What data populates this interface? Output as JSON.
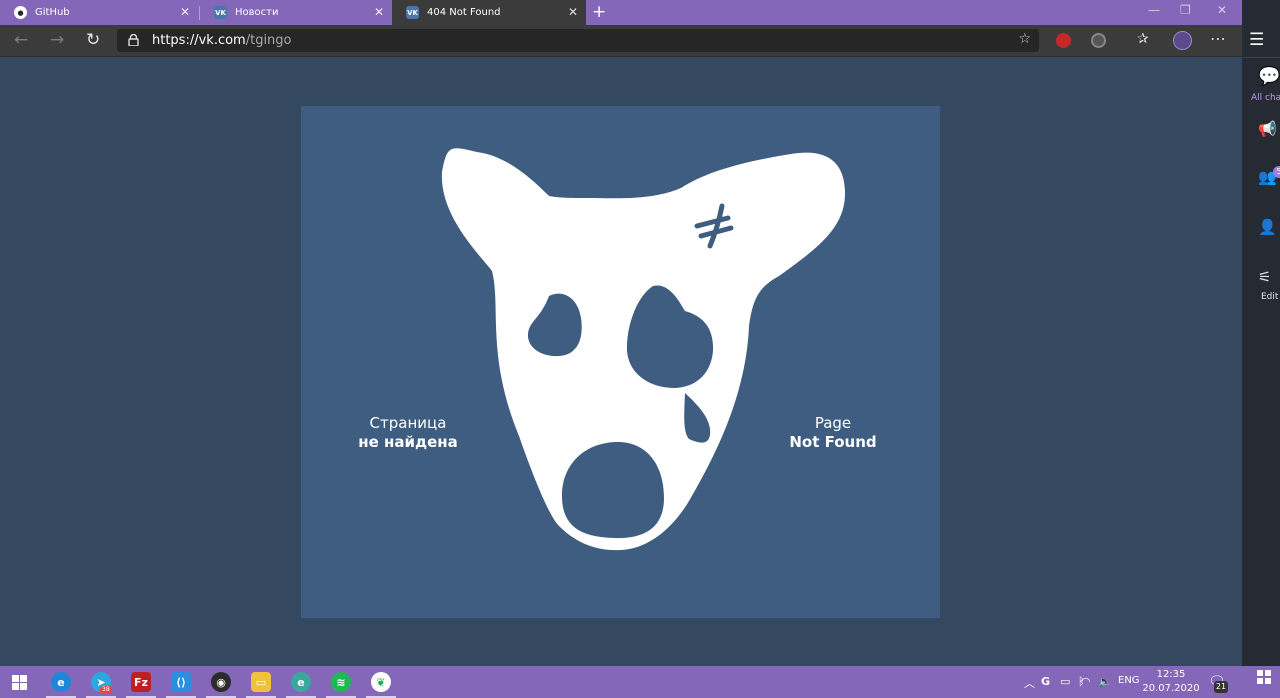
{
  "browser": {
    "tabs": [
      {
        "title": "GitHub",
        "icon": "github-icon",
        "active": false
      },
      {
        "title": "Новости",
        "icon": "vk-icon",
        "active": false
      },
      {
        "title": "404 Not Found",
        "icon": "vk-icon",
        "active": true
      }
    ],
    "new_tab_symbol": "+",
    "url": {
      "scheme_host": "https://vk.com",
      "path": "/tgingo"
    },
    "colors": {
      "titlebar": "#8467b8",
      "toolbar": "#3b3b3b",
      "address_bar": "#262626"
    }
  },
  "page": {
    "background": "#34495f",
    "card_background": "#3f5d80",
    "caption_left": {
      "line1": "Страница",
      "line2": "не найдена"
    },
    "caption_right": {
      "line1": "Page",
      "line2": "Not Found"
    },
    "illustration": "sad-vk-dog-icon"
  },
  "side_panel": {
    "items": [
      {
        "label": "All cha",
        "icon": "chat-icon",
        "badge": ""
      },
      {
        "label": "",
        "icon": "megaphone-icon",
        "badge": ""
      },
      {
        "label": "",
        "icon": "contacts-icon",
        "badge": "5"
      },
      {
        "label": "",
        "icon": "user-icon",
        "badge": ""
      },
      {
        "label": "Edit",
        "icon": "sliders-icon",
        "badge": ""
      }
    ]
  },
  "taskbar": {
    "apps": [
      {
        "name": "edge-icon",
        "color": "#1e88d8"
      },
      {
        "name": "telegram-icon",
        "color": "#2ea6df",
        "badge": "38"
      },
      {
        "name": "filezilla-icon",
        "color": "#bf1f1f"
      },
      {
        "name": "vscode-icon",
        "color": "#2a8fe0"
      },
      {
        "name": "obs-icon",
        "color": "#2b2b2b"
      },
      {
        "name": "file-explorer-icon",
        "color": "#f0c23b"
      },
      {
        "name": "edge-dev-icon",
        "color": "#3aa7a0"
      },
      {
        "name": "spotify-icon",
        "color": "#1db954"
      },
      {
        "name": "mongodb-compass-icon",
        "color": "#13aa52"
      }
    ],
    "tray": {
      "language": "ENG",
      "time": "12:35",
      "date": "20.07.2020",
      "notifications": "21"
    }
  }
}
